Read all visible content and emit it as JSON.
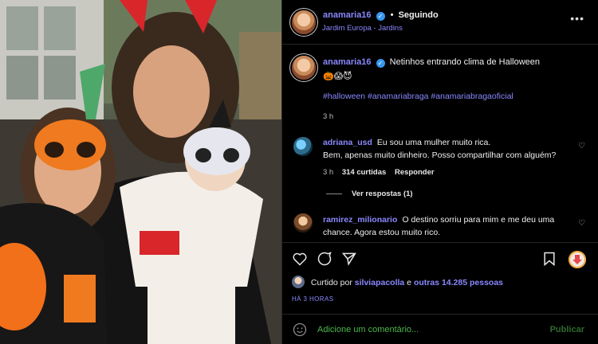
{
  "header": {
    "username": "anamaria16",
    "separator": "•",
    "follow_label": "Seguindo",
    "location": "Jardim Europa - Jardins",
    "more_icon": "more-horizontal-icon"
  },
  "caption": {
    "username": "anamaria16",
    "text": "Netinhos entrando clima de Halloween",
    "emojis": "🎃😱😈",
    "hashtags": "#halloween #anamariabraga #anamariabragaoficial",
    "time": "3 h"
  },
  "comments": [
    {
      "username": "adriana_usd",
      "line1": "Eu sou uma mulher muito rica.",
      "line2": "Bem, apenas muito dinheiro. Posso compartilhar com alguém?",
      "time": "3 h",
      "likes": "314 curtidas",
      "reply_label": "Responder",
      "view_replies": "Ver respostas (1)"
    },
    {
      "username": "ramirez_milionario",
      "line1": "O destino sorriu para mim e me deu uma",
      "line2": "chance. Agora estou muito rico."
    }
  ],
  "likes": {
    "prefix": "Curtido por",
    "user": "silviapacolla",
    "conj": "e",
    "others": "outras 14.285 pessoas"
  },
  "post_time": "HÁ 3 HORAS",
  "add_comment": {
    "placeholder": "Adicione um comentário...",
    "publish_label": "Publicar"
  },
  "colors": {
    "link": "#8a88ff",
    "background": "#000000",
    "divider": "#262626",
    "verified": "#3897f0",
    "comment_placeholder": "#4cb84c"
  }
}
